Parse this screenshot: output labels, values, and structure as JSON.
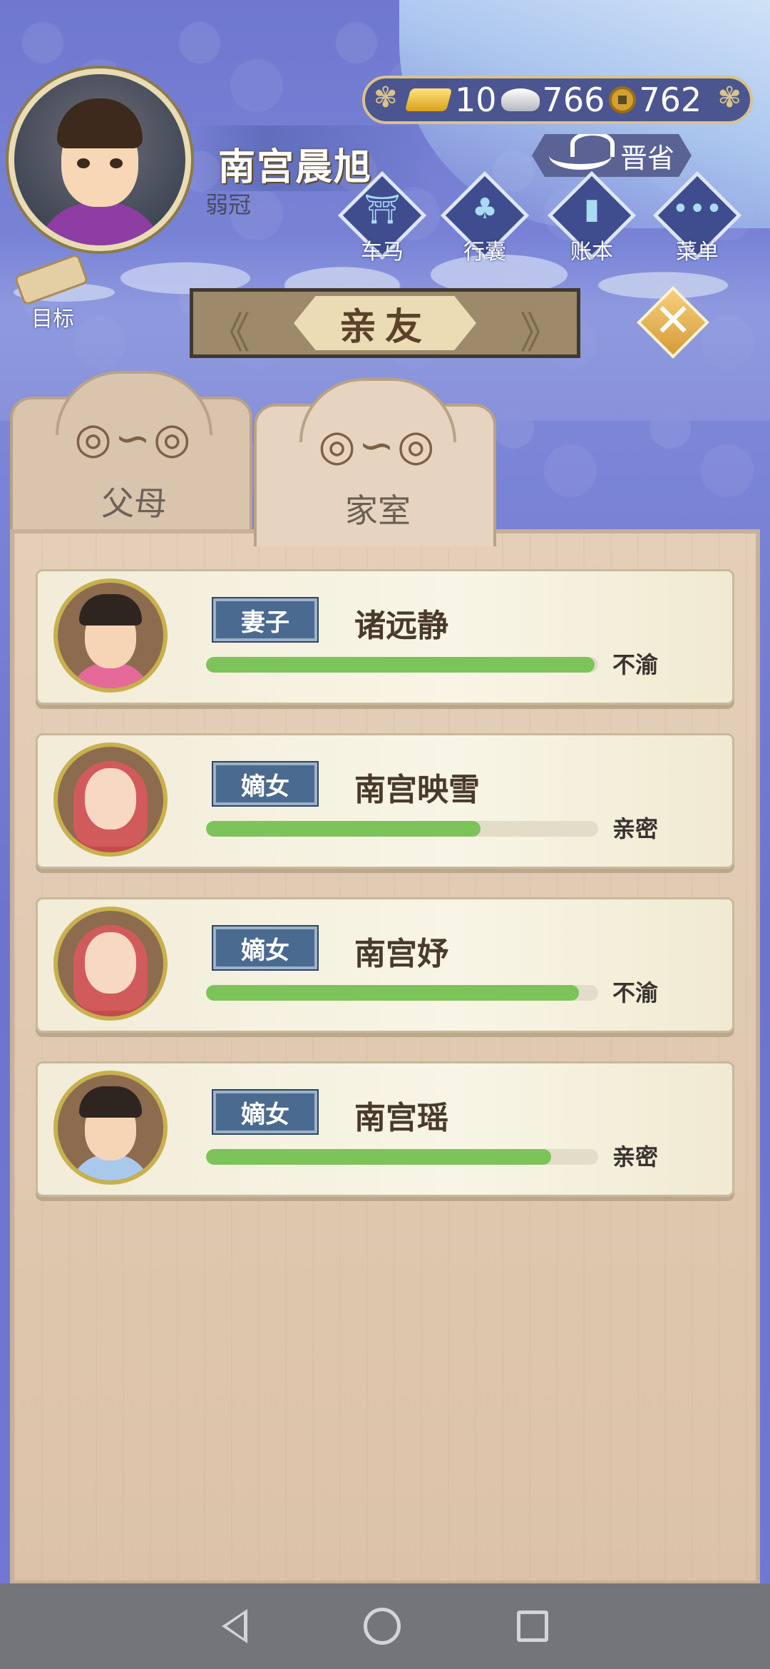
{
  "player": {
    "name": "南宫晨旭",
    "age_title": "弱冠"
  },
  "currency": {
    "gold": "10",
    "silver": "766",
    "coins": "762"
  },
  "province": "晋省",
  "menu": [
    {
      "label": "车马",
      "icon": "carriage-icon"
    },
    {
      "label": "行囊",
      "icon": "bundle-icon"
    },
    {
      "label": "账本",
      "icon": "ledger-icon"
    },
    {
      "label": "菜单",
      "icon": "more-icon"
    }
  ],
  "goal_label": "目标",
  "page_title": "亲友",
  "tabs": [
    {
      "label": "父母",
      "active": false
    },
    {
      "label": "家室",
      "active": true
    }
  ],
  "relations": [
    {
      "role": "妻子",
      "name": "诸远静",
      "status": "不渝",
      "affection": 0.99,
      "avatar": "wife-avatar"
    },
    {
      "role": "嫡女",
      "name": "南宫映雪",
      "status": "亲密",
      "affection": 0.7,
      "avatar": "baby-avatar"
    },
    {
      "role": "嫡女",
      "name": "南宫妤",
      "status": "不渝",
      "affection": 0.95,
      "avatar": "baby-avatar"
    },
    {
      "role": "嫡女",
      "name": "南宫瑶",
      "status": "亲密",
      "affection": 0.88,
      "avatar": "girl-avatar"
    }
  ],
  "colors": {
    "bar_fill": "#7cc35a",
    "role_badge": "#4b6a8f",
    "sky": "#7178d2"
  }
}
